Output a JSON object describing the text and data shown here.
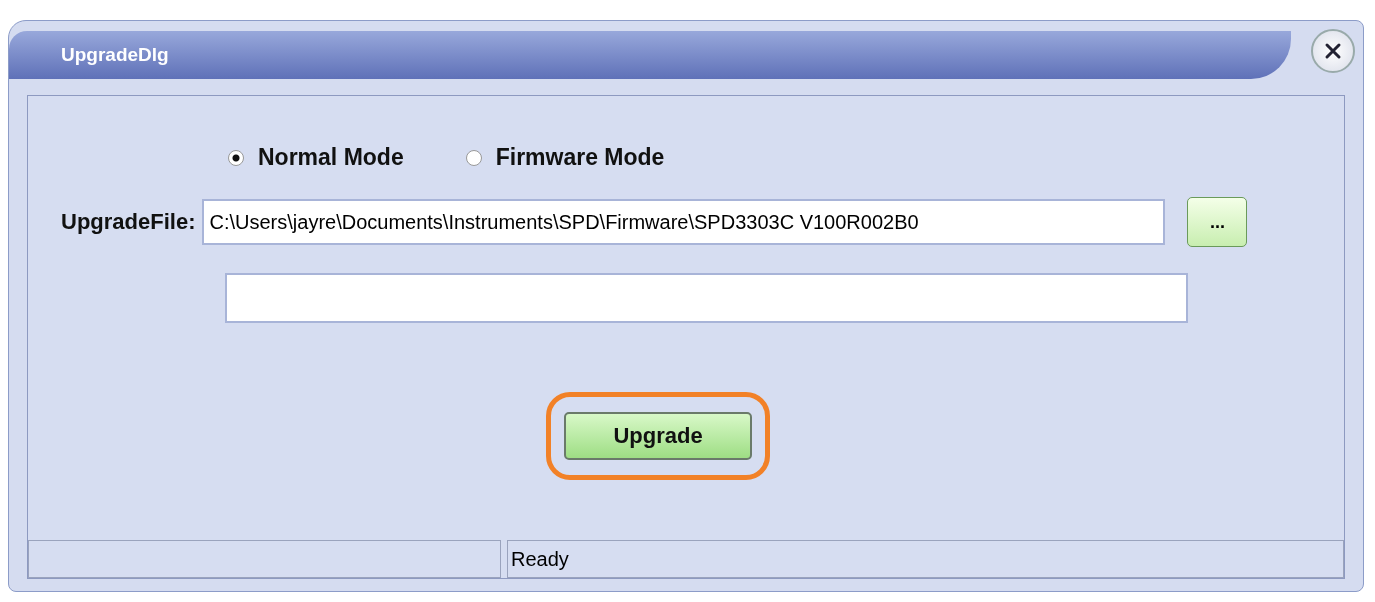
{
  "window": {
    "title": "UpgradeDlg"
  },
  "modes": [
    {
      "label": "Normal Mode",
      "selected": true
    },
    {
      "label": "Firmware Mode",
      "selected": false
    }
  ],
  "upgrade_file": {
    "label": "UpgradeFile:",
    "value": "C:\\Users\\jayre\\Documents\\Instruments\\SPD\\Firmware\\SPD3303C V100R002B0",
    "browse_label": "..."
  },
  "upgrade_button": {
    "label": "Upgrade",
    "highlighted": true
  },
  "status_bar": {
    "cells": [
      "",
      "Ready"
    ]
  }
}
